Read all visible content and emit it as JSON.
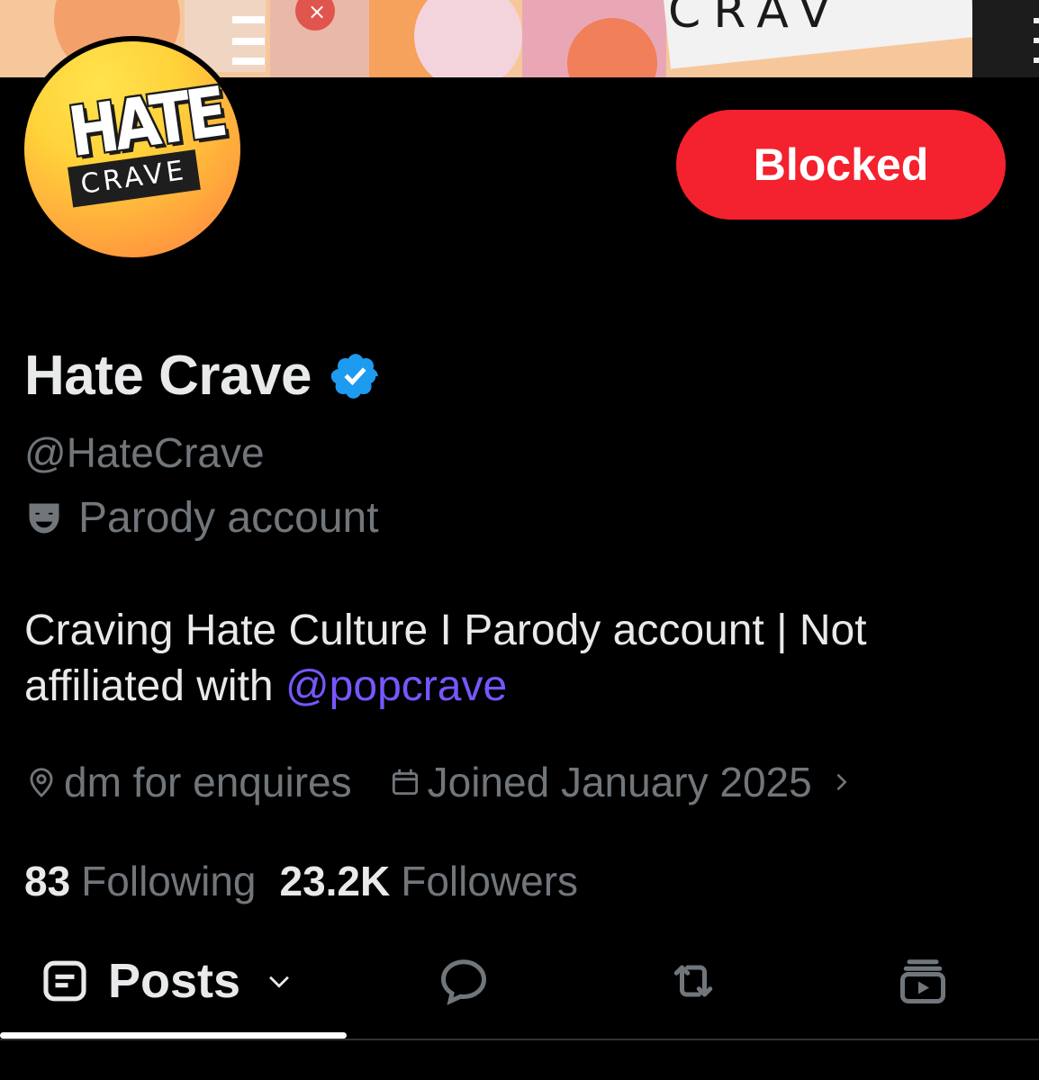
{
  "banner": {
    "partial_text": "CRAV"
  },
  "avatar": {
    "logo_top": "HATE",
    "logo_bottom": "CRAVE"
  },
  "actions": {
    "blocked_label": "Blocked"
  },
  "profile": {
    "display_name": "Hate Crave",
    "handle": "@HateCrave",
    "parody_label": "Parody account",
    "bio_text": "Craving Hate Culture I Parody account | Not affiliated with ",
    "bio_mention": "@popcrave",
    "location": "dm for enquires",
    "joined": "Joined January 2025"
  },
  "stats": {
    "following_count": "83",
    "following_label": "Following",
    "followers_count": "23.2K",
    "followers_label": "Followers"
  },
  "tabs": {
    "posts_label": "Posts"
  },
  "colors": {
    "background": "#000000",
    "primary_text": "#e7e9ea",
    "secondary_text": "#71767b",
    "blocked_red": "#f4212e",
    "mention_purple": "#7856ff",
    "verified_blue": "#1d9bf0"
  },
  "icons": {
    "verified": "verified-badge-icon",
    "parody": "theater-mask-icon",
    "location": "location-pin-icon",
    "calendar": "calendar-icon",
    "chevron": "chevron-right-icon",
    "posts": "posts-list-icon",
    "replies": "speech-bubble-icon",
    "reposts": "repost-icon",
    "media": "media-play-icon"
  }
}
